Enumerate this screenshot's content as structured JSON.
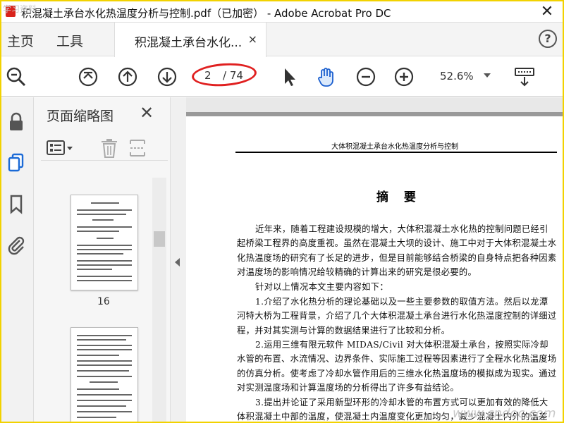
{
  "window": {
    "title": "积混凝土承台水化热温度分析与控制.pdf（已加密） - Adobe Acrobat Pro DC",
    "close_glyph": "✕"
  },
  "menubar": {
    "home": "主页",
    "tools": "工具"
  },
  "tab": {
    "label": "积混凝土承台水化...",
    "close_glyph": "×"
  },
  "help": {
    "glyph": "?"
  },
  "toolbar": {
    "current_page": "2",
    "total_pages": "/ 74",
    "zoom": "52.6%"
  },
  "thumb_panel": {
    "title": "页面缩略图",
    "close_glyph": "✕",
    "page_label": "16"
  },
  "document": {
    "running_head": "大体积混凝土承台水化热温度分析与控制",
    "abstract_title": "摘  要",
    "paragraphs": [
      "近年来，随着工程建设规模的增大，大体积混凝土水化热的控制问题已经引起桥梁工程界的高度重视。虽然在混凝土大坝的设计、施工中对于大体积混凝土水化热温度场的研究有了长足的进步，但是目前能够结合桥梁的自身特点把各种因素对温度场的影响情况给较精确的计算出来的研究是很必要的。",
      "针对以上情况本文主要内容如下：",
      "1.介绍了水化热分析的理论基础以及一些主要参数的取值方法。然后以龙潭河特大桥为工程背景，介绍了几个大体积混凝土承台进行水化热温度控制的详细过程，并对其实测与计算的数据结果进行了比较和分析。",
      "2.运用三维有限元软件 MIDAS/Civil 对大体积混凝土承台，按照实际冷却水管的布置、水流情况、边界条件、实际施工过程等因素进行了全程水化热温度场的仿真分析。使考虑了冷却水管作用后的三维水化热温度场的模拟成为现实。通过对实测温度场和计算温度场的分析得出了许多有益结论。",
      "3.提出并论证了采用新型环形的冷却水管的布置方式可以更加有效的降低大体积混凝土中部的温度，使混凝土内温度变化更加均匀，减少混凝土内外的温差"
    ]
  },
  "watermarks": {
    "bottom": "www.cndoc.com",
    "top": "学习资料"
  }
}
